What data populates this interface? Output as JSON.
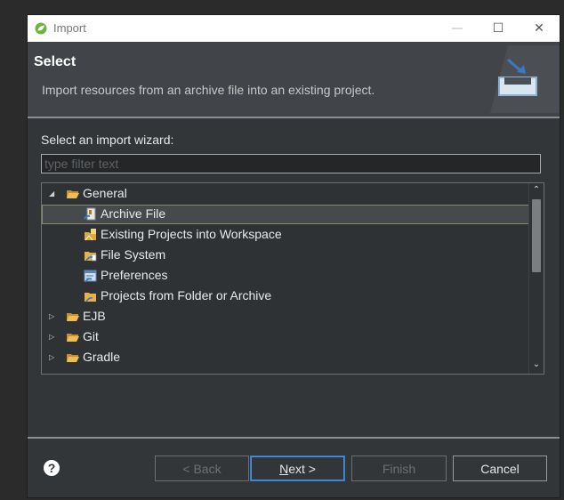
{
  "window": {
    "title": "Import",
    "controls": {
      "minimize": "—",
      "maximize": "☐",
      "close": "✕"
    }
  },
  "header": {
    "title": "Select",
    "description": "Import resources from an archive file into an existing project."
  },
  "body": {
    "wizard_label": "Select an import wizard:",
    "filter_placeholder": "type filter text",
    "tree": [
      {
        "label": "General",
        "expanded": true,
        "level": 0,
        "icon": "folder-open-icon"
      },
      {
        "label": "Archive File",
        "level": 1,
        "selected": true,
        "icon": "archive-file-icon"
      },
      {
        "label": "Existing Projects into Workspace",
        "level": 1,
        "icon": "existing-projects-icon"
      },
      {
        "label": "File System",
        "level": 1,
        "icon": "file-system-icon"
      },
      {
        "label": "Preferences",
        "level": 1,
        "icon": "preferences-icon"
      },
      {
        "label": "Projects from Folder or Archive",
        "level": 1,
        "icon": "projects-folder-icon"
      },
      {
        "label": "EJB",
        "expanded": false,
        "level": 0,
        "icon": "folder-open-icon"
      },
      {
        "label": "Git",
        "expanded": false,
        "level": 0,
        "icon": "folder-open-icon"
      },
      {
        "label": "Gradle",
        "expanded": false,
        "level": 0,
        "icon": "folder-open-icon"
      }
    ]
  },
  "footer": {
    "help": "?",
    "back": "< Back",
    "next_mnemonic": "N",
    "next_rest": "ext >",
    "finish": "Finish",
    "cancel": "Cancel"
  },
  "colors": {
    "accent": "#2f7fd8",
    "folder": "#e8b04a",
    "window_bg": "#333639",
    "header_bg": "#414549"
  }
}
